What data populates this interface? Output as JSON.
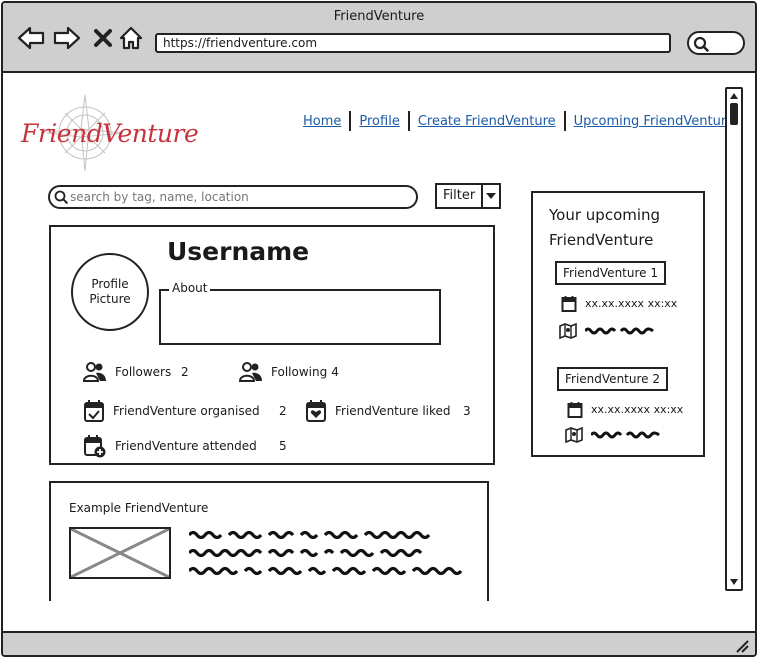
{
  "window": {
    "title": "FriendVenture"
  },
  "browser": {
    "url": "https://friendventure.com",
    "icons": [
      "back-arrow-icon",
      "forward-arrow-icon",
      "close-x-icon",
      "home-icon",
      "search-icon"
    ]
  },
  "logo": {
    "text": "FriendVenture",
    "color": "#c8323c"
  },
  "nav": {
    "items": [
      {
        "label": "Home"
      },
      {
        "label": "Profile"
      },
      {
        "label": "Create FriendVenture"
      },
      {
        "label": "Upcoming FriendVentures"
      }
    ],
    "link_color": "#1c5aa6"
  },
  "search": {
    "placeholder": "search by tag, name, location"
  },
  "filter": {
    "label": "Filter"
  },
  "profile": {
    "username": "Username",
    "avatar_label_line1": "Profile",
    "avatar_label_line2": "Picture",
    "about_label": "About",
    "about_value": "",
    "stats": {
      "followers_label": "Followers",
      "followers_value": "2",
      "following_label": "Following",
      "following_value": "4",
      "organised_label": "FriendVenture organised",
      "organised_value": "2",
      "liked_label": "FriendVenture liked",
      "liked_value": "3",
      "attended_label": "FriendVenture attended",
      "attended_value": "5"
    }
  },
  "upcoming": {
    "title_line1": "Your upcoming",
    "title_line2": "FriendVenture",
    "items": [
      {
        "name": "FriendVenture 1",
        "datetime": "xx.xx.xxxx xx:xx"
      },
      {
        "name": "FriendVenture 2",
        "datetime": "xx.xx.xxxx xx:xx"
      }
    ]
  },
  "example": {
    "title": "Example FriendVenture"
  }
}
